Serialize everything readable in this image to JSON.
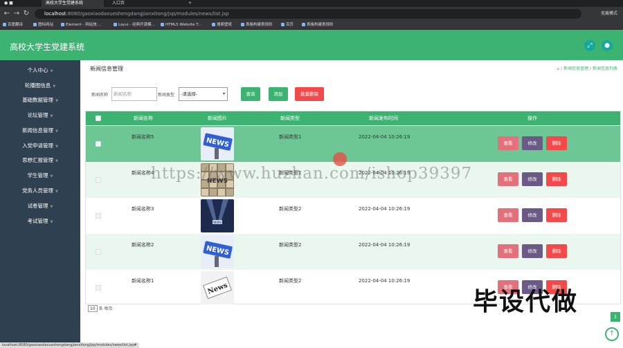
{
  "browser": {
    "tabs": [
      {
        "title": "高校大学生党建系统",
        "active": true
      },
      {
        "title": "入口页",
        "active": false
      }
    ],
    "new_tab": "+",
    "url_host": "localhost",
    "url_rest": ":8080/gaoxiaodaxueshengdangjianxitong/jsp/modules/news/list.jsp",
    "profile": "无痕模式",
    "bookmarks": [
      "百度翻译",
      "图标网站",
      "Element - 网站快...",
      "Layui - 经典开源模...",
      "HTML5 Website T...",
      "搜索壁纸",
      "表格构建表规则",
      "百页",
      "表格构建表规则"
    ],
    "status_url": "localhost:8080/gaoxiaodaxueshengdangjianxitong/jsp/modules/news/list.jsp#"
  },
  "app": {
    "title": "高校大学生党建系统",
    "header_icons": [
      "expand-icon",
      "user-icon"
    ]
  },
  "sidebar": {
    "items": [
      {
        "label": "个人中心"
      },
      {
        "label": "轮播图信息"
      },
      {
        "label": "基础数据管理"
      },
      {
        "label": "论坛管理"
      },
      {
        "label": "新闻信息管理"
      },
      {
        "label": "入党申请管理"
      },
      {
        "label": "思想汇报管理"
      },
      {
        "label": "学生管理"
      },
      {
        "label": "党务人员管理"
      },
      {
        "label": "试卷管理"
      },
      {
        "label": "考试管理"
      }
    ]
  },
  "page": {
    "title": "新闻信息管理",
    "breadcrumb": {
      "sep": "/",
      "items": [
        "新闻信息管理",
        "新闻信息列表"
      ]
    }
  },
  "search": {
    "name_label": "新闻名称",
    "name_placeholder": "新闻名称",
    "type_label": "新闻类型",
    "type_selected": "-请选择-",
    "query_btn": "查询",
    "add_btn": "添加",
    "batch_delete_btn": "批量删除"
  },
  "table": {
    "headers": [
      "新闻名称",
      "新闻图片",
      "新闻类型",
      "新闻发布时间",
      "操作"
    ],
    "action_labels": {
      "view": "查看",
      "edit": "修改",
      "delete": "删除"
    },
    "rows": [
      {
        "name": "新闻名称5",
        "type": "新闻类型1",
        "time": "2022-04-04 10:26:19",
        "image_text": "NEWS",
        "image_style": "blue"
      },
      {
        "name": "新闻名称4",
        "type": "新闻类型2",
        "time": "2022-04-04 10:26:19",
        "image_text": "NEWS",
        "image_style": "tiles"
      },
      {
        "name": "新闻名称3",
        "type": "新闻类型2",
        "time": "2022-04-04 10:26:19",
        "image_text": "NEWS",
        "image_style": "stage"
      },
      {
        "name": "新闻名称2",
        "type": "新闻类型2",
        "time": "2022-04-04 10:26:19",
        "image_text": "NEWS",
        "image_style": "blue"
      },
      {
        "name": "新闻名称1",
        "type": "新闻类型2",
        "time": "2022-04-04 10:26:19",
        "image_text": "News",
        "image_style": "paper"
      }
    ]
  },
  "pagination": {
    "page_size": "10",
    "per_page_label": "条 每页",
    "current_page": "1"
  },
  "overlays": {
    "watermark": "https://www.huzhan.com/ishop39397",
    "stamp": "毕设代做"
  },
  "colors": {
    "primary": "#3cb371",
    "sidebar_bg": "#2f4050",
    "danger": "#f24a4a",
    "view_btn": "#e2717c",
    "edit_btn": "#6a5a85"
  }
}
